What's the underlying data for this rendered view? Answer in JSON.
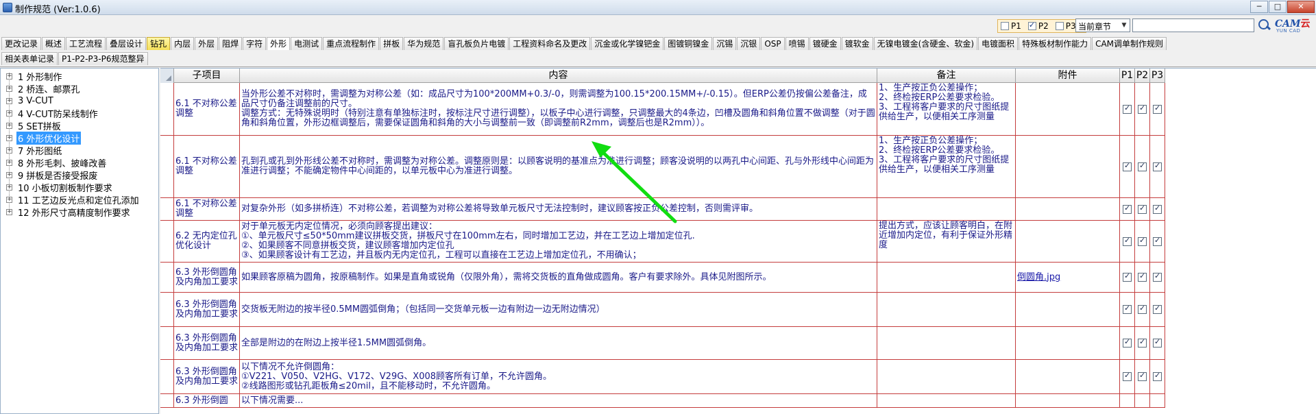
{
  "window": {
    "title": "制作规范 (Ver:1.0.6)",
    "min": "─",
    "max": "□",
    "close": "✕"
  },
  "toolbar": {
    "p1": "P1",
    "p2": "P2",
    "p3": "P3",
    "chapter_value": "当前章节",
    "search_value": "",
    "logo_text": "CAM",
    "logo_text2": "云",
    "logo_sub": "YUN CAD"
  },
  "tabs_row1": [
    "更改记录",
    "概述",
    "工艺流程",
    "叠层设计",
    "钻孔",
    "内层",
    "外层",
    "阻焊",
    "字符",
    "外形",
    "电测试",
    "重点流程制作",
    "拼板",
    "华为规范",
    "盲孔板负片电镀",
    "工程资料命名及更改",
    "沉金或化学镍钯金",
    "图镀铜镍金",
    "沉锡",
    "沉银",
    "OSP",
    "喷锡",
    "镀硬金",
    "镀软金",
    "无镍电镀金(含硬金、软金)",
    "电镀面积",
    "特殊板材制作能力",
    "CAM调单制作规则"
  ],
  "tabs_row2": [
    "相关表单记录",
    "P1-P2-P3-P6规范整异"
  ],
  "tree": [
    "1 外形制作",
    "2 桥连、邮票孔",
    "3 V-CUT",
    "4 V-CUT防呆线制作",
    "5 SET拼板",
    "6 外形优化设计",
    "7 外形图纸",
    "8 外形毛刺、披峰改善",
    "9 拼板是否接受报废",
    "10 小板切割板制作要求",
    "11 工艺边反光点和定位孔添加",
    "12 外形尺寸高精度制作要求"
  ],
  "grid": {
    "headers": [
      "子项目",
      "内容",
      "备注",
      "附件",
      "P1",
      "P2",
      "P3"
    ],
    "rows": [
      {
        "sub": "6.1 不对称公差调整",
        "content": "当外形公差不对称时，需调整为对称公差（如：成品尺寸为100*200MM+0.3/-0，则需调整为100.15*200.15MM+/-0.15）。但ERP公差仍按偏公差备注，成品尺寸仍备注调整前的尺寸。\n调整方式：无特殊说明时（特别注意有单独标注时，按标注尺寸进行调整），以板子中心进行调整，只调整最大的4条边，凹槽及圆角和斜角位置不做调整（对于圆角和斜角位置，外形边框调整后，需要保证圆角和斜角的大小与调整前一致（即调整前R2mm，调整后也是R2mm））。",
        "note": "1、生产按正负公差操作；\n2、终检按ERP公差要求检验。\n3、工程将客户要求的尺寸图纸提供给生产，以便相关工序测量",
        "attach": ""
      },
      {
        "sub": "6.1 不对称公差调整",
        "content": "孔到孔或孔到外形线公差不对称时，需调整为对称公差。调整原则是：以顾客说明的基准点为准进行调整；顾客没说明的以两孔中心间距、孔与外形线中心间距为准进行调整；不能确定物件中心间距的，以单元板中心为准进行调整。",
        "note": "1、生产按正负公差操作；\n2、终检按ERP公差要求检验。\n3、工程将客户要求的尺寸图纸提供给生产，以便相关工序测量",
        "attach": ""
      },
      {
        "sub": "6.1 不对称公差调整",
        "content": "对复杂外形（如多拼桥连）不对称公差，若调整为对称公差将导致单元板尺寸无法控制时，建议顾客按正负公差控制，否则需评审。",
        "note": "",
        "attach": ""
      },
      {
        "sub": "6.2 无内定位孔优化设计",
        "content": "对于单元板无内定位情况，必须向顾客提出建议：\n①、单元板尺寸≤50*50mm建议拼板交货，拼板尺寸在100mm左右，同时增加工艺边，并在工艺边上增加定位孔.\n②、如果顾客不同意拼板交货，建议顾客增加内定位孔\n③、如果顾客设计有工艺边，并且板内无内定位孔，工程可以直接在工艺边上增加定位孔，不用确认；",
        "note": "提出方式，应该让顾客明白，在附近增加内定位，有利于保证外形精度",
        "attach": ""
      },
      {
        "sub": "6.3 外形倒圆角及内角加工要求",
        "content": "如果顾客原稿为圆角，按原稿制作。如果是直角或锐角（仅限外角），需将交货板的直角做成圆角。客户有要求除外。具体见附图所示。",
        "note": "",
        "attach": "倒圆角.jpg"
      },
      {
        "sub": "6.3 外形倒圆角及内角加工要求",
        "content": "交货板无附边的按半径0.5MM圆弧倒角；（包括同一交货单元板一边有附边一边无附边情况）",
        "note": "",
        "attach": ""
      },
      {
        "sub": "6.3 外形倒圆角及内角加工要求",
        "content": "全部是附边的在附边上按半径1.5MM圆弧倒角。",
        "note": "",
        "attach": ""
      },
      {
        "sub": "6.3 外形倒圆角及内角加工要求",
        "content": "以下情况不允许倒圆角：\n①V221、V050、V2HG、V172、V29G、X008顾客所有订单，不允许圆角。\n②线路图形或钻孔距板角≤20mil，且不能移动时，不允许圆角。",
        "note": "",
        "attach": ""
      },
      {
        "sub": "6.3 外形倒圆",
        "content": "以下情况需要...",
        "note": "",
        "attach": ""
      }
    ]
  },
  "colors": {
    "grid_line": "#c43c3c",
    "text": "#1a1a88",
    "arrow": "#11dd11",
    "selected": "#3399ff"
  }
}
